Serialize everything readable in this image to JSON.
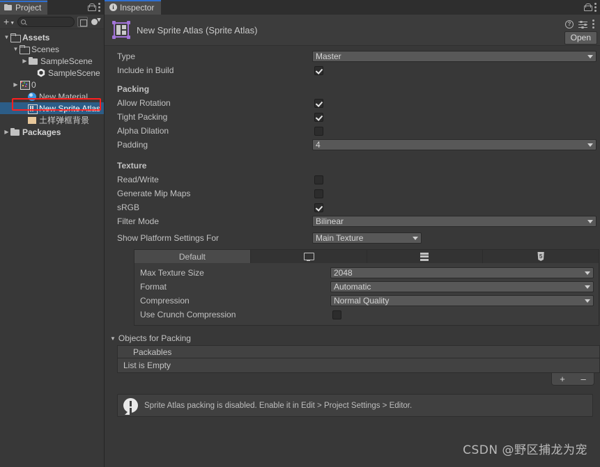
{
  "project_panel": {
    "tab_label": "Project",
    "toolbar": {
      "add_label": "+",
      "search_placeholder": ""
    },
    "tree": [
      {
        "label": "Assets",
        "depth": 0,
        "arrow": "▼",
        "icon": "folder-open-icon",
        "bold": true,
        "selected": false
      },
      {
        "label": "Scenes",
        "depth": 1,
        "arrow": "▼",
        "icon": "folder-open-icon",
        "bold": false,
        "selected": false
      },
      {
        "label": "SampleScene",
        "depth": 2,
        "arrow": "▶",
        "icon": "folder-icon",
        "bold": false,
        "selected": false
      },
      {
        "label": "SampleScene",
        "depth": 2,
        "arrow": "",
        "icon": "unity-scene-icon",
        "bold": false,
        "selected": false
      },
      {
        "label": "0",
        "depth": 1,
        "arrow": "▶",
        "icon": "sprite-sheet-icon",
        "bold": false,
        "selected": false
      },
      {
        "label": "New Material",
        "depth": 1,
        "arrow": "",
        "icon": "material-icon",
        "bold": false,
        "selected": false
      },
      {
        "label": "New Sprite Atlas",
        "depth": 1,
        "arrow": "",
        "icon": "sprite-atlas-icon",
        "bold": false,
        "selected": true
      },
      {
        "label": "土样弹框背景",
        "depth": 1,
        "arrow": "",
        "icon": "texture-icon",
        "bold": false,
        "selected": false
      },
      {
        "label": "Packages",
        "depth": 0,
        "arrow": "▶",
        "icon": "folder-icon",
        "bold": true,
        "selected": false
      }
    ]
  },
  "inspector": {
    "tab_label": "Inspector",
    "title": "New Sprite Atlas (Sprite Atlas)",
    "open_button": "Open",
    "fields": {
      "type_label": "Type",
      "type_value": "Master",
      "include_in_build_label": "Include in Build",
      "include_in_build_checked": true
    },
    "packing": {
      "section_title": "Packing",
      "allow_rotation_label": "Allow Rotation",
      "allow_rotation_checked": true,
      "tight_packing_label": "Tight Packing",
      "tight_packing_checked": true,
      "alpha_dilation_label": "Alpha Dilation",
      "alpha_dilation_checked": false,
      "padding_label": "Padding",
      "padding_value": "4"
    },
    "texture": {
      "section_title": "Texture",
      "read_write_label": "Read/Write",
      "read_write_checked": false,
      "mip_maps_label": "Generate Mip Maps",
      "mip_maps_checked": false,
      "srgb_label": "sRGB",
      "srgb_checked": true,
      "filter_mode_label": "Filter Mode",
      "filter_mode_value": "Bilinear",
      "platform_settings_label": "Show Platform Settings For",
      "platform_settings_value": "Main Texture"
    },
    "platform_tabs": [
      {
        "label": "Default",
        "icon": "",
        "active": true
      },
      {
        "label": "",
        "icon": "monitor-icon",
        "active": false
      },
      {
        "label": "",
        "icon": "server-icon",
        "active": false
      },
      {
        "label": "",
        "icon": "html5-icon",
        "active": false
      }
    ],
    "platform_settings": {
      "max_texture_size_label": "Max Texture Size",
      "max_texture_size_value": "2048",
      "format_label": "Format",
      "format_value": "Automatic",
      "compression_label": "Compression",
      "compression_value": "Normal Quality",
      "crunch_label": "Use Crunch Compression",
      "crunch_checked": false
    },
    "objects_for_packing": {
      "section_title": "Objects for Packing",
      "list_header": "Packables",
      "empty_text": "List is Empty",
      "add_label": "+",
      "remove_label": "–"
    },
    "help_message": "Sprite Atlas packing is disabled. Enable it in Edit > Project Settings > Editor."
  },
  "watermark": "CSDN @野区捕龙为宠",
  "colors": {
    "background": "#383838",
    "panel_header": "#2e2e2e",
    "tab_active": "#4b4b4b",
    "selection_blue": "#2c5d87",
    "highlight_red": "#ff1f1f",
    "accent_blue": "#2e6fd0",
    "field_bg": "#585858"
  }
}
